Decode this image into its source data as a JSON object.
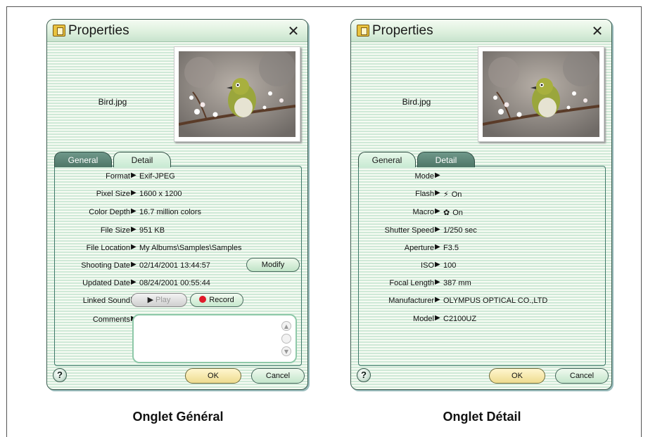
{
  "dialog_title": "Properties",
  "close_glyph": "✕",
  "filename": "Bird.jpg",
  "tabs": {
    "general": "General",
    "detail": "Detail"
  },
  "general_rows": [
    {
      "label": "Format",
      "value": "Exif-JPEG"
    },
    {
      "label": "Pixel Size",
      "value": "1600 x 1200"
    },
    {
      "label": "Color Depth",
      "value": "16.7 million colors"
    },
    {
      "label": "File Size",
      "value": "951 KB"
    },
    {
      "label": "File Location",
      "value": "My Albums\\Samples\\Samples"
    },
    {
      "label": "Shooting Date",
      "value": "02/14/2001 13:44:57"
    },
    {
      "label": "Updated Date",
      "value": "08/24/2001 00:55:44"
    },
    {
      "label": "Linked Sound",
      "value": ""
    },
    {
      "label": "Comments",
      "value": ""
    }
  ],
  "detail_rows": [
    {
      "label": "Mode",
      "value": ""
    },
    {
      "label": "Flash",
      "icon": "⚡",
      "value": "On"
    },
    {
      "label": "Macro",
      "icon": "✿",
      "value": "On"
    },
    {
      "label": "Shutter Speed",
      "value": "1/250 sec"
    },
    {
      "label": "Aperture",
      "value": "F3.5"
    },
    {
      "label": "ISO",
      "value": "100"
    },
    {
      "label": "Focal Length",
      "value": "387 mm"
    },
    {
      "label": "Manufacturer",
      "value": "OLYMPUS OPTICAL CO.,LTD"
    },
    {
      "label": "Model",
      "value": "C2100UZ"
    }
  ],
  "buttons": {
    "modify": "Modify",
    "play": "Play",
    "record": "Record",
    "ok": "OK",
    "cancel": "Cancel",
    "help": "?"
  },
  "arrow_glyph": "▶",
  "captions": {
    "general": "Onglet Général",
    "detail": "Onglet Détail"
  },
  "colors": {
    "panel_border": "#40786a",
    "active_tab": "#5a8273",
    "ok_button": "#eedc8f",
    "record_dot": "#e01a2a"
  }
}
